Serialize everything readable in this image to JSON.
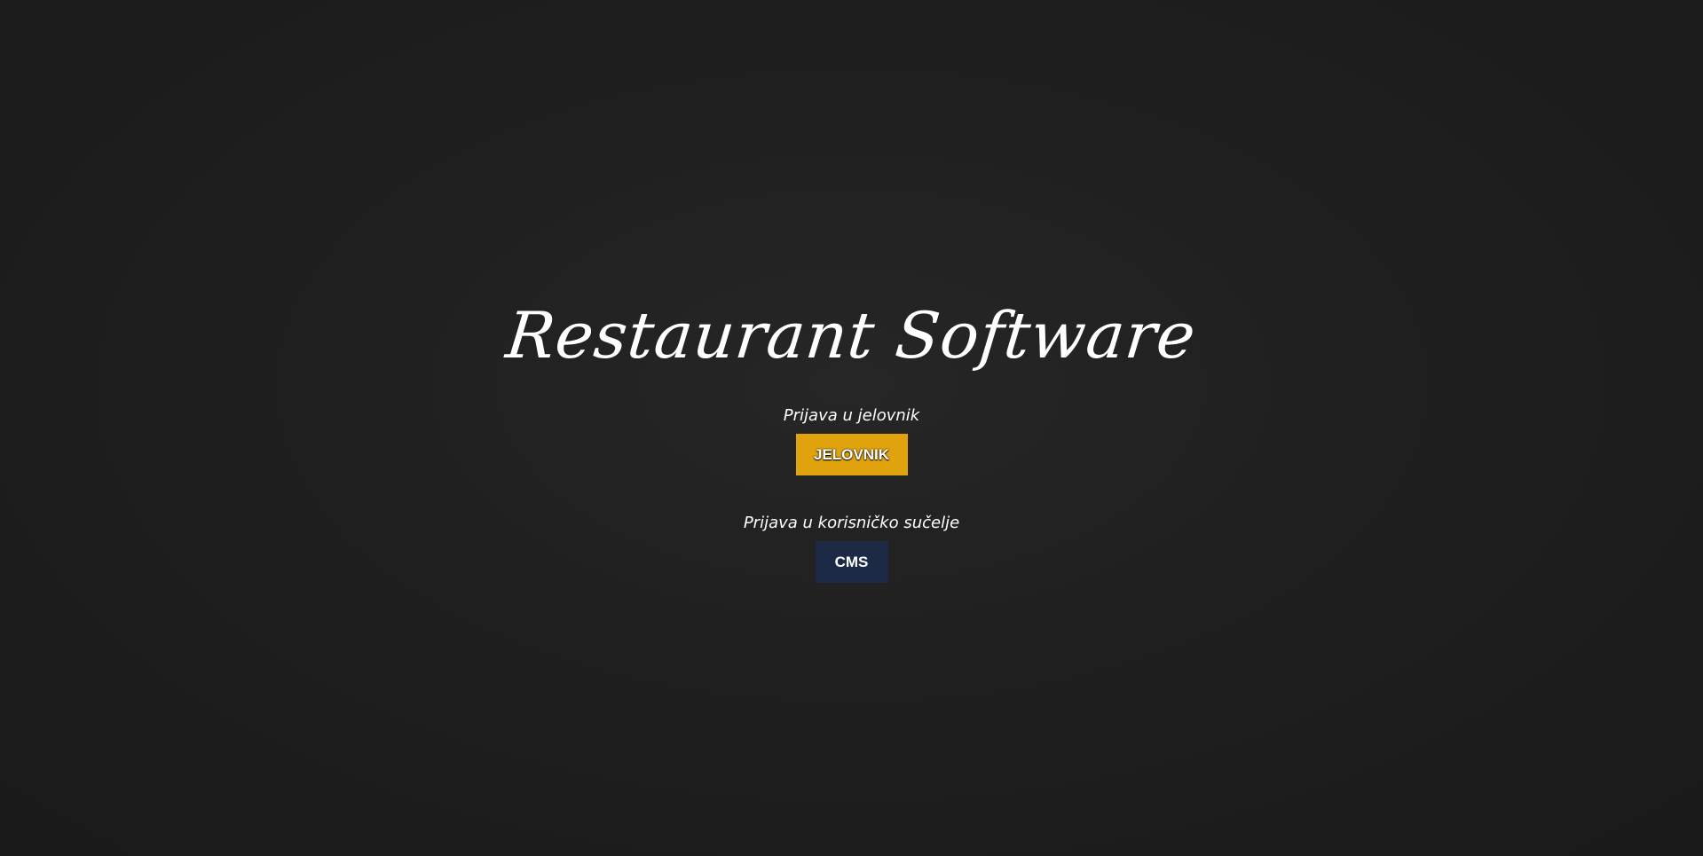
{
  "app": {
    "title": "Restaurant Software"
  },
  "menu_login": {
    "label": "Prijava u jelovnik",
    "button_label": "JELOVNIK"
  },
  "cms_login": {
    "label": "Prijava u korisničko sučelje",
    "button_label": "CMS"
  },
  "colors": {
    "background": "#1f1f1f",
    "menu_button": "#e0a30e",
    "cms_button": "#1d2a46"
  }
}
